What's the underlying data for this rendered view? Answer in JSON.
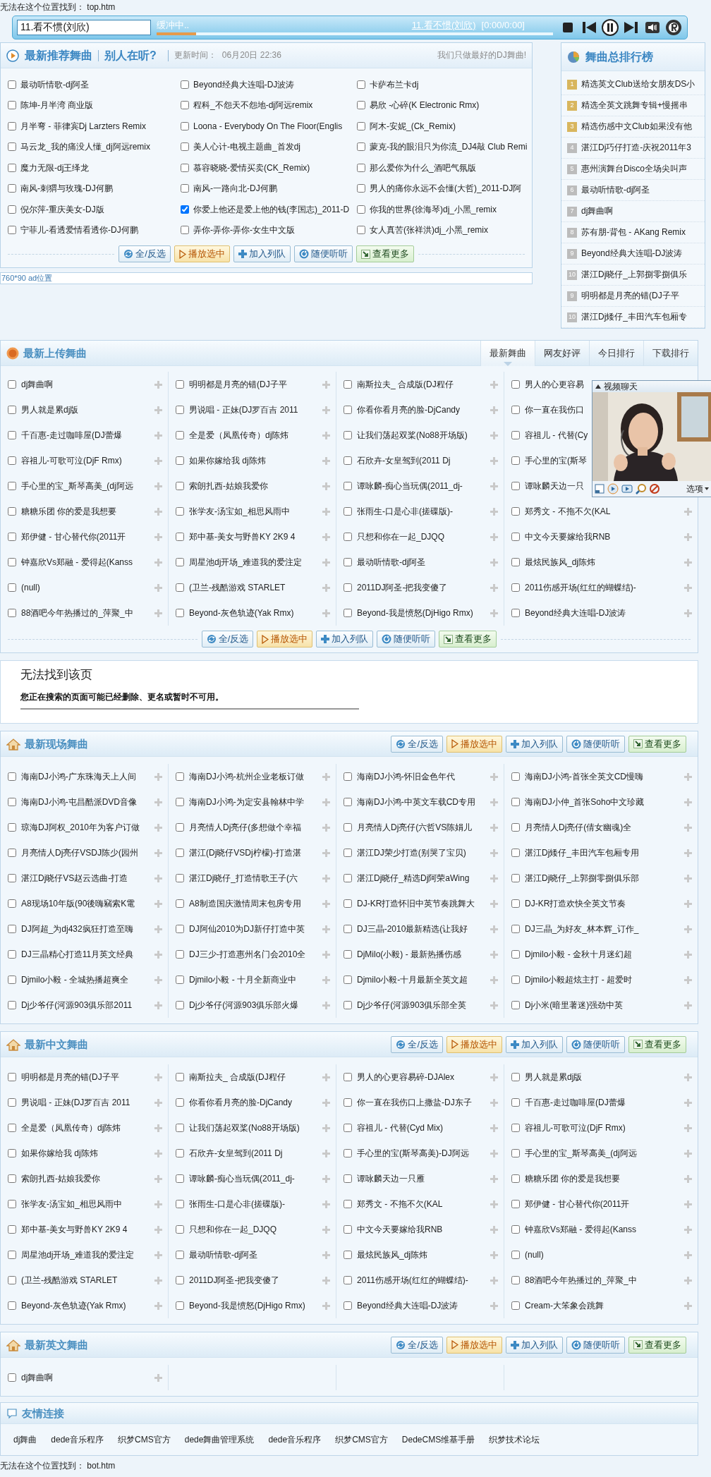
{
  "missing_top": "无法在这个位置找到： top.htm",
  "player": {
    "current": "11.看不惯(刘欣)",
    "status": "缓冲中..",
    "level": 0.1,
    "now_playing": "11.看不惯(刘欣)",
    "time": "[0:00/0:00]"
  },
  "recommended": {
    "title": "最新推荐舞曲",
    "subtitle": "别人在听?",
    "updated_label": "更新时间：",
    "updated": "06月20日 22:36",
    "slogan": "我们只做最好的DJ舞曲!",
    "songs": [
      {
        "title": "最动听情歌-dj阿圣",
        "checked": false
      },
      {
        "title": "Beyond经典大连唱-DJ波涛",
        "checked": false
      },
      {
        "title": "卡萨布兰卡dj",
        "checked": false
      },
      {
        "title": "陈坤-月半湾 商业版",
        "checked": false
      },
      {
        "title": "程科_不怨天不怨地-dj阿远remix",
        "checked": false
      },
      {
        "title": "易欣 -心碎(K Electronic Rmx)",
        "checked": false
      },
      {
        "title": "月半弯 - 菲律宾Dj Larzters Remix",
        "checked": false
      },
      {
        "title": "Loona - Everybody On The Floor(Englis",
        "checked": false
      },
      {
        "title": "阿木-安妮_(Ck_Remix)",
        "checked": false
      },
      {
        "title": "马云龙_我的痛没人懂_dj阿远remix",
        "checked": false
      },
      {
        "title": "美人心计-电视主题曲_首发dj",
        "checked": false
      },
      {
        "title": "蒙克-我的眼泪只为你流_DJ4敲 Club Remi",
        "checked": false
      },
      {
        "title": "魔力无限-dj王绎龙",
        "checked": false
      },
      {
        "title": "慕容晓晓-爱情买卖(CK_Remix)",
        "checked": false
      },
      {
        "title": "那么爱你为什么_酒吧气氛版",
        "checked": false
      },
      {
        "title": "南风-刺猬与玫瑰-DJ何鹏",
        "checked": false
      },
      {
        "title": "南风-一路向北-DJ何鹏",
        "checked": false
      },
      {
        "title": "男人的痛你永远不会懂(大哲)_2011-DJ阿",
        "checked": false
      },
      {
        "title": "倪尔萍-重庆美女-DJ版",
        "checked": false
      },
      {
        "title": "你爱上他还是爱上他的钱(李国志)_2011-D",
        "checked": true
      },
      {
        "title": "你我的世界(徐海琴)dj_小黑_remix",
        "checked": false
      },
      {
        "title": "宁菲儿-看透爱情看透你-DJ何鹏",
        "checked": false
      },
      {
        "title": "弄你-弄你-弄你-女生中文版",
        "checked": false
      },
      {
        "title": "女人真苦(张祥洪)dj_小黑_remix",
        "checked": false
      }
    ],
    "buttons": [
      {
        "kind": "select",
        "label": "全/反选"
      },
      {
        "kind": "play",
        "label": "播放选中"
      },
      {
        "kind": "add",
        "label": "加入列队"
      },
      {
        "kind": "random",
        "label": "随便听听"
      },
      {
        "kind": "more",
        "label": "查看更多"
      }
    ]
  },
  "ad": "760*90 ad位置",
  "ranking": {
    "title": "舞曲总排行榜",
    "items": [
      {
        "rank": "1",
        "title": "精选英文Club送给女朋友DS小",
        "color": "#d8b65e"
      },
      {
        "rank": "2",
        "title": "精选全英文跳舞专辑+慢摇串",
        "color": "#d8b65e"
      },
      {
        "rank": "3",
        "title": "精选伤感中文Club如果没有他",
        "color": "#d8b65e"
      },
      {
        "rank": "4",
        "title": "湛江Dj巧仔打造-庆祝2011年3",
        "color": "#bcbcbc"
      },
      {
        "rank": "5",
        "title": "惠州演舞台Disco全场尖叫声",
        "color": "#bcbcbc"
      },
      {
        "rank": "6",
        "title": "最动听情歌-dj阿圣",
        "color": "#bcbcbc"
      },
      {
        "rank": "7",
        "title": "dj舞曲啊",
        "color": "#bcbcbc"
      },
      {
        "rank": "8",
        "title": "苏有朋-背包 - AKang Remix",
        "color": "#bcbcbc"
      },
      {
        "rank": "9",
        "title": "Beyond经典大连唱-DJ波涛",
        "color": "#bcbcbc"
      },
      {
        "rank": "10",
        "title": "湛江Dj晓仔_上郭捌零捌俱乐",
        "color": "#bcbcbc"
      },
      {
        "rank": "9",
        "title": "明明都是月亮的错(DJ子平",
        "color": "#bcbcbc"
      },
      {
        "rank": "10",
        "title": "湛江Dj矮仔_丰田汽车包厢专",
        "color": "#bcbcbc"
      }
    ]
  },
  "latest_uploads": {
    "title": "最新上传舞曲",
    "tabs": [
      {
        "label": "最新舞曲",
        "selected": true
      },
      {
        "label": "网友好评",
        "selected": false
      },
      {
        "label": "今日排行",
        "selected": false
      },
      {
        "label": "下载排行",
        "selected": false
      }
    ],
    "songs": [
      {
        "title": "dj舞曲啊",
        "checked": false
      },
      {
        "title": "明明都是月亮的错(DJ子平",
        "checked": false
      },
      {
        "title": "南斯拉夫_ 合成版(DJ程仔",
        "checked": false
      },
      {
        "title": "男人的心更容易",
        "checked": false,
        "hidden_icon": true
      },
      {
        "title": "男人就是累dj版",
        "checked": false
      },
      {
        "title": "男说唱 - 正妹(DJ罗百吉 2011",
        "checked": false
      },
      {
        "title": "你看你看月亮的脸-DjCandy",
        "checked": false
      },
      {
        "title": "你一直在我伤口",
        "checked": false,
        "hidden_icon": true
      },
      {
        "title": "千百惠-走过咖啡屋(DJ蕾爆",
        "checked": false
      },
      {
        "title": "全是爱（凤凰传奇）dj陈炜",
        "checked": false
      },
      {
        "title": "让我们荡起双桨(No88开场版)",
        "checked": false
      },
      {
        "title": "容祖儿 - 代替(Cy",
        "checked": false,
        "hidden_icon": true
      },
      {
        "title": "容祖儿-可歌可泣(DjF Rmx)",
        "checked": false
      },
      {
        "title": "如果你嫁给我 dj陈炜",
        "checked": false
      },
      {
        "title": "石欣卉-女皇驾到(2011 Dj",
        "checked": false
      },
      {
        "title": "手心里的宝(斯琴",
        "checked": false,
        "hidden_icon": true
      },
      {
        "title": "手心里的宝_斯琴高美_(dj阿远",
        "checked": false
      },
      {
        "title": "索朗扎西-姑娘我爱你",
        "checked": false
      },
      {
        "title": "谭咏麟-痴心当玩偶(2011_dj-",
        "checked": false
      },
      {
        "title": "谭咏麟天边一只",
        "checked": false,
        "hidden_icon": true
      },
      {
        "title": "糖糖乐团 你的爱是我想要",
        "checked": false
      },
      {
        "title": "张学友-汤宝如_相思风雨中",
        "checked": false
      },
      {
        "title": "张雨生-口是心非(搓碟版)-",
        "checked": false
      },
      {
        "title": "郑秀文 - 不拖不欠(KAL",
        "checked": false
      },
      {
        "title": "郑伊健 - 甘心替代你(2011开",
        "checked": false
      },
      {
        "title": "郑中基-美女与野兽KY 2K9 4",
        "checked": false
      },
      {
        "title": "只想和你在一起_DJQQ",
        "checked": false
      },
      {
        "title": "中文今天要嫁给我RNB",
        "checked": false
      },
      {
        "title": "钟嘉欣Vs郑融 - 爱得起(Kanss",
        "checked": false
      },
      {
        "title": "周星池dj开场_难道我的爱注定",
        "checked": false
      },
      {
        "title": "最动听情歌-dj阿圣",
        "checked": false
      },
      {
        "title": "最炫民族风_dj陈炜",
        "checked": false
      },
      {
        "title": "(null)",
        "checked": false
      },
      {
        "title": "(卫兰-残酷游戏 STARLET",
        "checked": false
      },
      {
        "title": "2011DJ阿圣-把我变傻了",
        "checked": false
      },
      {
        "title": "2011伤感开场(红红的蝴蝶结)-",
        "checked": false
      },
      {
        "title": "88酒吧今年热播过的_萍聚_中",
        "checked": false
      },
      {
        "title": "Beyond-灰色轨迹(Yak Rmx)",
        "checked": false
      },
      {
        "title": "Beyond-我是愤怒(DjHigo Rmx)",
        "checked": false
      },
      {
        "title": "Beyond经典大连唱-DJ波涛",
        "checked": false
      }
    ],
    "buttons": [
      {
        "kind": "select",
        "label": "全/反选"
      },
      {
        "kind": "play",
        "label": "播放选中"
      },
      {
        "kind": "add",
        "label": "加入列队"
      },
      {
        "kind": "random",
        "label": "随便听听"
      },
      {
        "kind": "more",
        "label": "查看更多"
      }
    ]
  },
  "video_chat": {
    "title": "视频聊天",
    "options": "选项"
  },
  "not_found": {
    "title": "无法找到该页",
    "message": "您正在搜索的页面可能已经删除、更名或暂时不可用。"
  },
  "live_sets": {
    "title": "最新现场舞曲",
    "buttons": [
      {
        "kind": "select",
        "label": "全/反选"
      },
      {
        "kind": "play",
        "label": "播放选中"
      },
      {
        "kind": "add",
        "label": "加入列队"
      },
      {
        "kind": "random",
        "label": "随便听听"
      },
      {
        "kind": "more",
        "label": "查看更多"
      }
    ],
    "songs": [
      {
        "title": "海南DJ小鸿-广东珠海天上人间",
        "checked": false
      },
      {
        "title": "海南DJ小鸿-杭州企业老板订做",
        "checked": false
      },
      {
        "title": "海南DJ小鸿-怀旧金色年代",
        "checked": false
      },
      {
        "title": "海南DJ小鸿-首张全英文CD慢嗨",
        "checked": false
      },
      {
        "title": "海南DJ小鸿-屯昌酷派DVD音像",
        "checked": false
      },
      {
        "title": "海南DJ小鸿-为定安县翰林中学",
        "checked": false
      },
      {
        "title": "海南DJ小鸿-中英文车载CD专用",
        "checked": false
      },
      {
        "title": "海南DJ小仲_首张Soho中文珍藏",
        "checked": false
      },
      {
        "title": "琼海DJ阿权_2010年为客户订做",
        "checked": false
      },
      {
        "title": "月亮情人Dj亮仔(多想做个幸福",
        "checked": false
      },
      {
        "title": "月亮情人Dj亮仔(六哲VS陈娟儿",
        "checked": false
      },
      {
        "title": "月亮情人Dj亮仔(倩女幽魂)全",
        "checked": false
      },
      {
        "title": "月亮情人Dj亮仔VSDJ陈少(园州",
        "checked": false
      },
      {
        "title": "湛江(Dj晓仔VSDj柠檬)-打造湛",
        "checked": false
      },
      {
        "title": "湛江DJ荣少打造(别哭了宝贝)",
        "checked": false
      },
      {
        "title": "湛江Dj矮仔_丰田汽车包厢专用",
        "checked": false
      },
      {
        "title": "湛江Dj晓仔VS赵云选曲-打造",
        "checked": false
      },
      {
        "title": "湛江Dj晓仔_打造情歌王子(六",
        "checked": false
      },
      {
        "title": "湛江Dj晓仔_精选Dj阿荣aWing",
        "checked": false
      },
      {
        "title": "湛江Dj晓仔_上郭捌零捌俱乐部",
        "checked": false
      },
      {
        "title": "A8现场10年版(90後嗨竊索K電",
        "checked": false
      },
      {
        "title": "A8制造国庆激情周末包房专用",
        "checked": false
      },
      {
        "title": "DJ-KR打造怀旧中英节奏跳舞大",
        "checked": false
      },
      {
        "title": "DJ-KR打造欢快全英文节奏",
        "checked": false
      },
      {
        "title": "DJ阿超_为dj432疯狂打造至嗨",
        "checked": false
      },
      {
        "title": "DJ阿仙2010为DJ新仔打造中英",
        "checked": false
      },
      {
        "title": "DJ三晶-2010最新精选(让我好",
        "checked": false
      },
      {
        "title": "DJ三晶_为好友_林本辉_订作_",
        "checked": false
      },
      {
        "title": "DJ三晶精心打造11月英文经典",
        "checked": false
      },
      {
        "title": "DJ三少-打造惠州名门会2010全",
        "checked": false
      },
      {
        "title": "DjMilo(小毅) - 最新热播伤感",
        "checked": false
      },
      {
        "title": "Djmilo小毅 - 金秋十月迷幻超",
        "checked": false
      },
      {
        "title": "Djmilo小毅 - 全城热播超爽全",
        "checked": false
      },
      {
        "title": "Djmilo小毅 - 十月全新商业中",
        "checked": false
      },
      {
        "title": "Djmilo小毅-十月最新全英文超",
        "checked": false
      },
      {
        "title": "Djmilo小毅超炫主打 - 超爱时",
        "checked": false
      },
      {
        "title": "Dj少爷仔(河源903俱乐部2011",
        "checked": false
      },
      {
        "title": "Dj少爷仔(河源903俱乐部火爆",
        "checked": false
      },
      {
        "title": "Dj少爷仔(河源903俱乐部全英",
        "checked": false
      },
      {
        "title": "Dj小米(暗里著迷)强劲中英",
        "checked": false
      }
    ]
  },
  "chinese": {
    "title": "最新中文舞曲",
    "buttons": [
      {
        "kind": "select",
        "label": "全/反选"
      },
      {
        "kind": "play",
        "label": "播放选中"
      },
      {
        "kind": "add",
        "label": "加入列队"
      },
      {
        "kind": "random",
        "label": "随便听听"
      },
      {
        "kind": "more",
        "label": "查看更多"
      }
    ],
    "songs": [
      {
        "title": "明明都是月亮的错(DJ子平",
        "checked": false
      },
      {
        "title": "南斯拉夫_ 合成版(DJ程仔",
        "checked": false
      },
      {
        "title": "男人的心更容易碎-DJAlex",
        "checked": false
      },
      {
        "title": "男人就是累dj版",
        "checked": false
      },
      {
        "title": "男说唱 - 正妹(DJ罗百吉 2011",
        "checked": false
      },
      {
        "title": "你看你看月亮的脸-DjCandy",
        "checked": false
      },
      {
        "title": "你一直在我伤口上撒盐-DJ东子",
        "checked": false
      },
      {
        "title": "千百惠-走过咖啡屋(DJ蕾爆",
        "checked": false
      },
      {
        "title": "全是爱（凤凰传奇）dj陈炜",
        "checked": false
      },
      {
        "title": "让我们荡起双桨(No88开场版)",
        "checked": false
      },
      {
        "title": "容祖儿 - 代替(Cyd Mix)",
        "checked": false
      },
      {
        "title": "容祖儿-可歌可泣(DjF Rmx)",
        "checked": false
      },
      {
        "title": "如果你嫁给我 dj陈炜",
        "checked": false
      },
      {
        "title": "石欣卉-女皇驾到(2011 Dj",
        "checked": false
      },
      {
        "title": "手心里的宝(斯琴高美)-DJ阿远",
        "checked": false
      },
      {
        "title": "手心里的宝_斯琴高美_(dj阿远",
        "checked": false
      },
      {
        "title": "索朗扎西-姑娘我爱你",
        "checked": false
      },
      {
        "title": "谭咏麟-痴心当玩偶(2011_dj-",
        "checked": false
      },
      {
        "title": "谭咏麟天边一只雁",
        "checked": false
      },
      {
        "title": "糖糖乐团 你的爱是我想要",
        "checked": false
      },
      {
        "title": "张学友-汤宝如_相思风雨中",
        "checked": false
      },
      {
        "title": "张雨生-口是心非(搓碟版)-",
        "checked": false
      },
      {
        "title": "郑秀文 - 不拖不欠(KAL",
        "checked": false
      },
      {
        "title": "郑伊健 - 甘心替代你(2011开",
        "checked": false
      },
      {
        "title": "郑中基-美女与野兽KY 2K9 4",
        "checked": false
      },
      {
        "title": "只想和你在一起_DJQQ",
        "checked": false
      },
      {
        "title": "中文今天要嫁给我RNB",
        "checked": false
      },
      {
        "title": "钟嘉欣Vs郑融 - 爱得起(Kanss",
        "checked": false
      },
      {
        "title": "周星池dj开场_难道我的爱注定",
        "checked": false
      },
      {
        "title": "最动听情歌-dj阿圣",
        "checked": false
      },
      {
        "title": "最炫民族风_dj陈炜",
        "checked": false
      },
      {
        "title": "(null)",
        "checked": false
      },
      {
        "title": "(卫兰-残酷游戏 STARLET",
        "checked": false
      },
      {
        "title": "2011DJ阿圣-把我变傻了",
        "checked": false
      },
      {
        "title": "2011伤感开场(红红的蝴蝶结)-",
        "checked": false
      },
      {
        "title": "88酒吧今年热播过的_萍聚_中",
        "checked": false
      },
      {
        "title": "Beyond-灰色轨迹(Yak Rmx)",
        "checked": false
      },
      {
        "title": "Beyond-我是愤怒(DjHigo Rmx)",
        "checked": false
      },
      {
        "title": "Beyond经典大连唱-DJ波涛",
        "checked": false
      },
      {
        "title": "Cream-大笨象会跳舞",
        "checked": false
      }
    ]
  },
  "english": {
    "title": "最新英文舞曲",
    "buttons": [
      {
        "kind": "select",
        "label": "全/反选"
      },
      {
        "kind": "play",
        "label": "播放选中"
      },
      {
        "kind": "add",
        "label": "加入列队"
      },
      {
        "kind": "random",
        "label": "随便听听"
      },
      {
        "kind": "more",
        "label": "查看更多"
      }
    ],
    "songs": [
      {
        "title": "dj舞曲啊",
        "checked": false
      }
    ]
  },
  "friend_links": {
    "title": "友情连接",
    "links": [
      "dj舞曲",
      "dede音乐程序",
      "织梦CMS官方",
      "dede舞曲管理系统",
      "dede音乐程序",
      "织梦CMS官方",
      "DedeCMS维基手册",
      "织梦技术论坛"
    ]
  },
  "missing_bottom": "无法在这个位置找到： bot.htm"
}
